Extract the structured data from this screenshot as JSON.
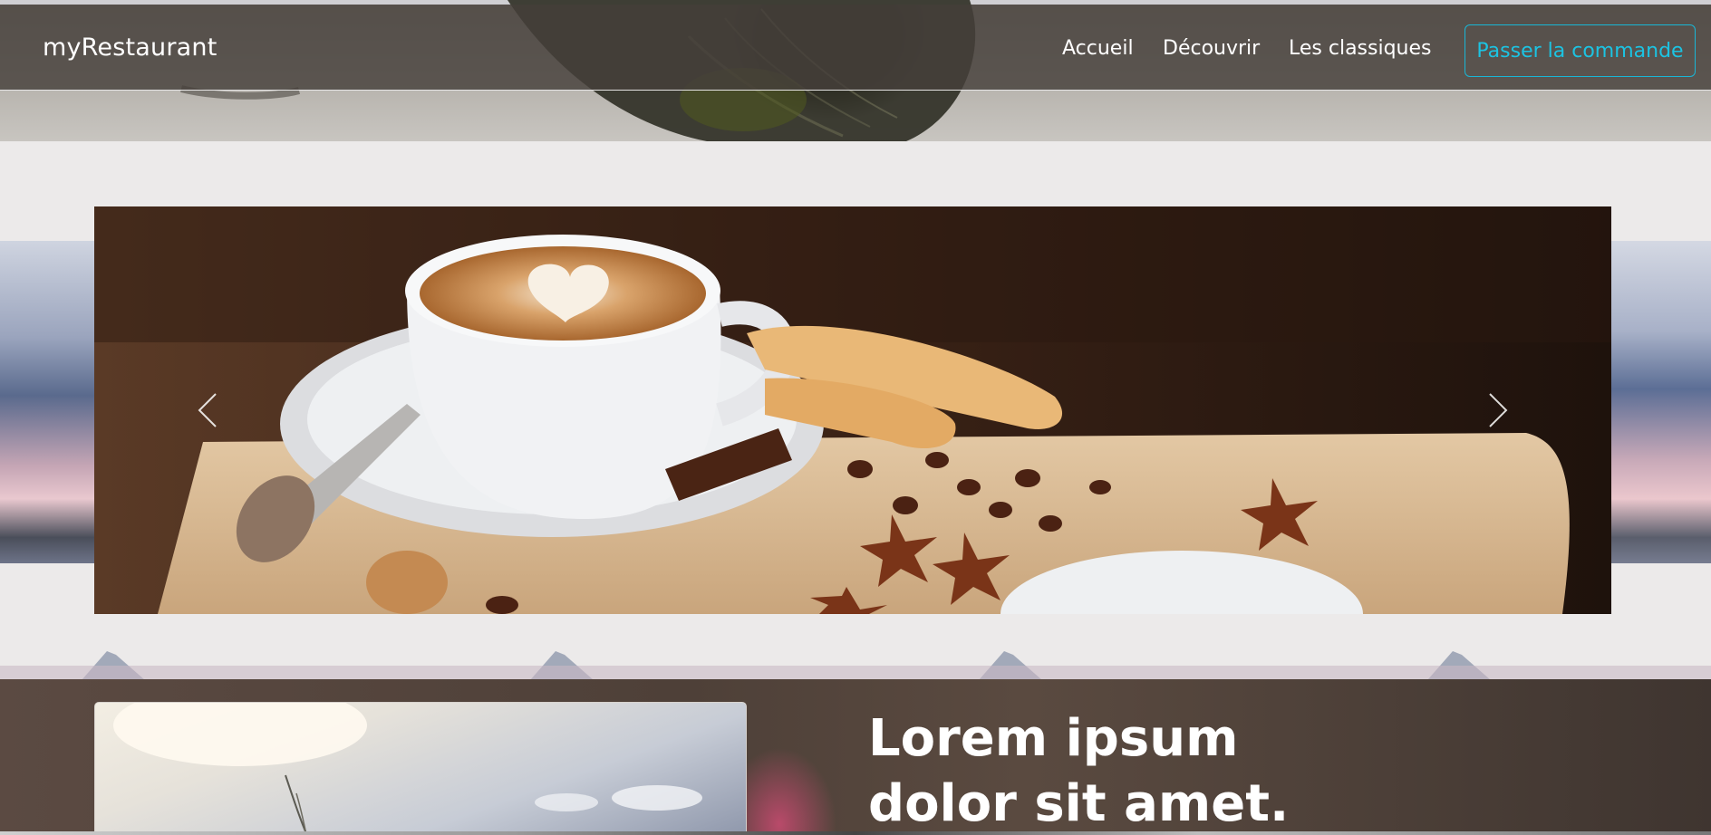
{
  "navbar": {
    "brand": "myRestaurant",
    "links": [
      {
        "label": "Accueil"
      },
      {
        "label": "Découvrir"
      },
      {
        "label": "Les classiques"
      }
    ],
    "order_button": "Passer la commande"
  },
  "carousel": {
    "prev_icon": "chevron-left-icon",
    "next_icon": "chevron-right-icon"
  },
  "feature": {
    "title": "Lorem ipsum dolor sit amet."
  },
  "colors": {
    "accent": "#1cc3e2",
    "navbar_bg": "#46403a",
    "text_light": "#ffffff"
  }
}
